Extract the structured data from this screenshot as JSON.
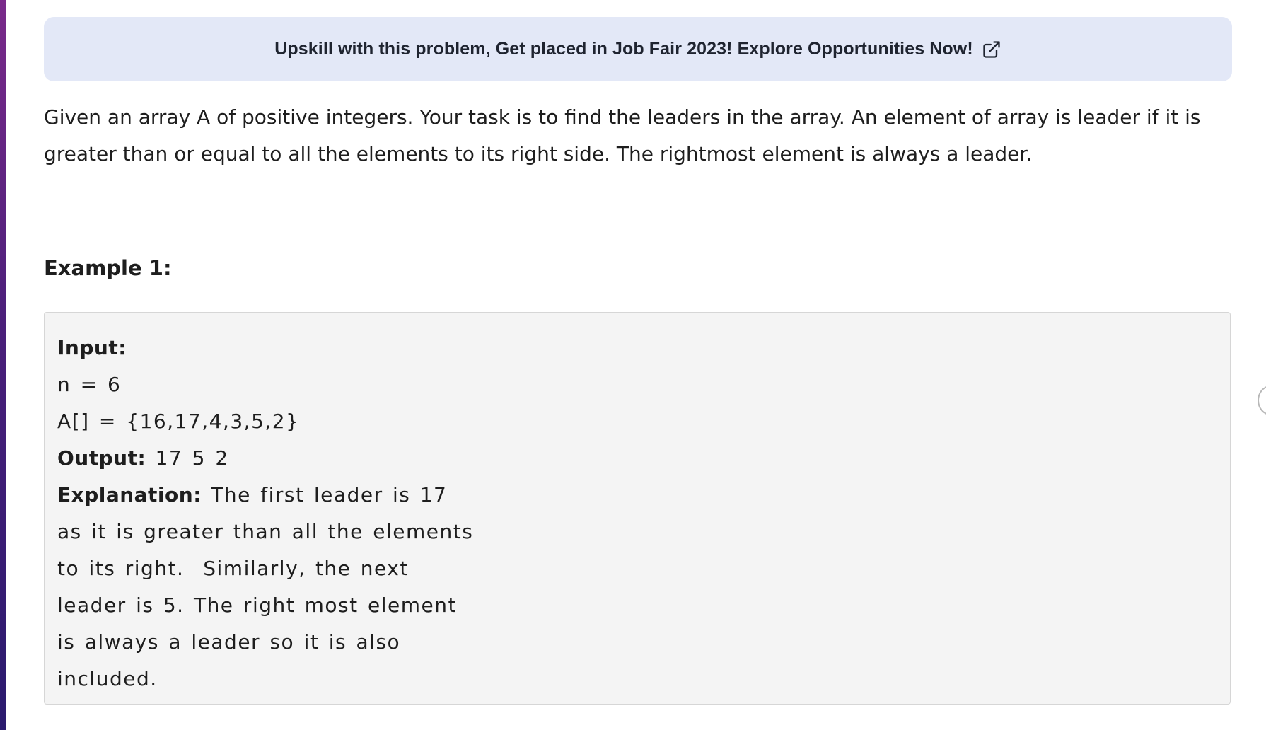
{
  "banner": {
    "text": "Upskill with this problem, Get placed in Job Fair 2023! Explore Opportunities Now!",
    "icon": "external-link-icon"
  },
  "problem": {
    "description": "Given an array A of positive integers. Your task is to find the leaders in the array. An element of array is leader if it is greater than or equal to all the elements to its right side. The rightmost element is always a leader."
  },
  "example": {
    "title": "Example 1:",
    "input_label": "Input:",
    "input_n": "n = 6",
    "input_array": "A[] = {16,17,4,3,5,2}",
    "output_label": "Output:",
    "output_value": " 17 5 2",
    "explanation_label": "Explanation:",
    "explanation_lines": [
      " The first leader is 17",
      "as it is greater than all the elements",
      "to its right.  Similarly, the next",
      "leader is 5. The right most element",
      "is always a leader so it is also",
      "included."
    ]
  },
  "colors": {
    "banner_bg": "#e3e8f7",
    "example_bg": "#f4f4f4",
    "left_edge": "#4a1f7a"
  }
}
